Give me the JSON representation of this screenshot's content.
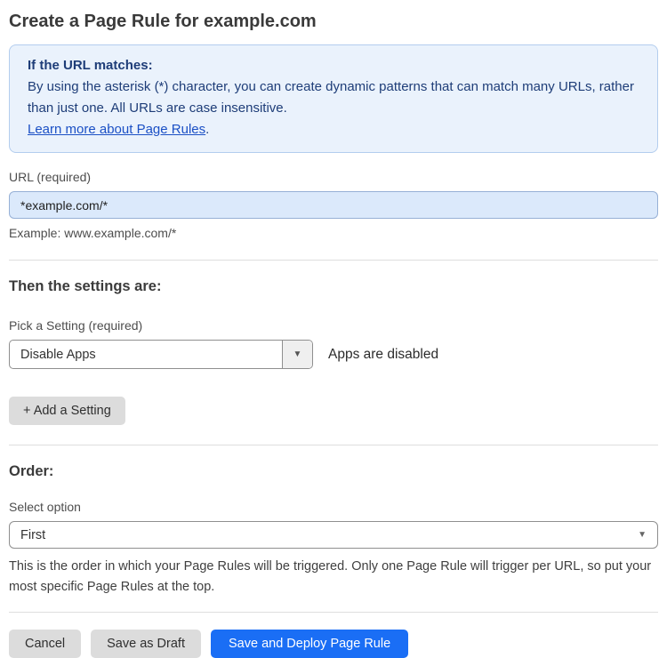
{
  "page": {
    "title": "Create a Page Rule for example.com"
  },
  "info_box": {
    "heading": "If the URL matches:",
    "body": "By using the asterisk (*) character, you can create dynamic patterns that can match many URLs, rather than just one. All URLs are case insensitive.",
    "link_label": "Learn more about Page Rules",
    "link_suffix": "."
  },
  "url_field": {
    "label": "URL (required)",
    "value": "*example.com/*",
    "helper": "Example: www.example.com/*"
  },
  "settings": {
    "heading": "Then the settings are:",
    "picker_label": "Pick a Setting (required)",
    "selected_setting": "Disable Apps",
    "status_text": "Apps are disabled",
    "add_button_label": "+ Add a Setting"
  },
  "order": {
    "heading": "Order:",
    "label": "Select option",
    "selected_option": "First",
    "helper": "This is the order in which your Page Rules will be triggered. Only one Page Rule will trigger per URL, so put your most specific Page Rules at the top."
  },
  "footer": {
    "cancel_label": "Cancel",
    "save_draft_label": "Save as Draft",
    "save_deploy_label": "Save and Deploy Page Rule"
  },
  "icons": {
    "caret_down": "▼"
  },
  "colors": {
    "accent_blue": "#1a6ef5",
    "info_bg": "#eaf2fc",
    "info_border": "#b3cdee",
    "info_text": "#1e3d78",
    "link_blue": "#1b50c5",
    "input_bg": "#dbe9fb",
    "button_gray": "#dcdcdc"
  }
}
